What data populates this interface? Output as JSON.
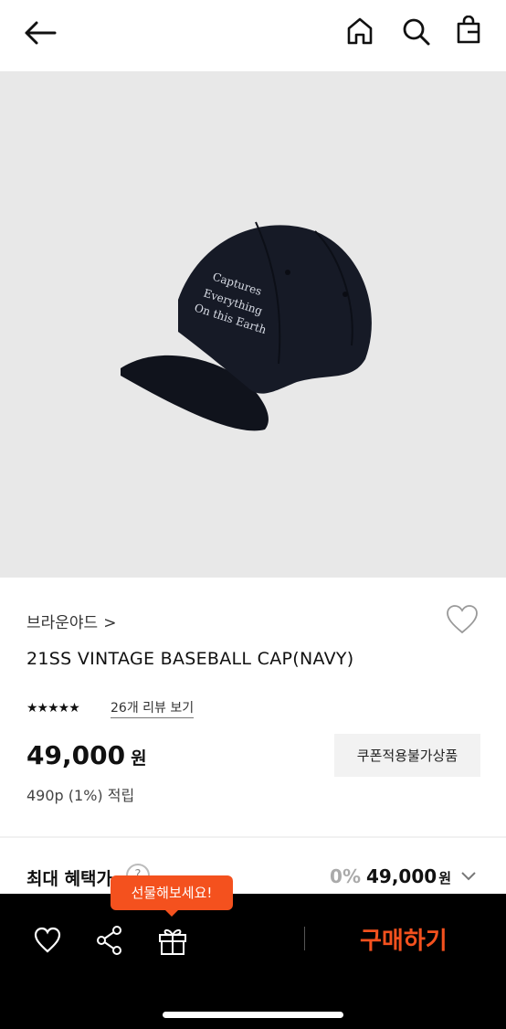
{
  "header": {
    "back_icon": "arrow-left-icon",
    "home_icon": "home-icon",
    "search_icon": "search-icon",
    "bag_icon": "shopping-bag-icon"
  },
  "product": {
    "image_alt": "navy baseball cap with embroidered text",
    "cap_text": [
      "Captures",
      "Everything",
      "On this Earth"
    ],
    "brand": "브라운야드",
    "brand_chevron": ">",
    "title": "21SS VINTAGE BASEBALL CAP(NAVY)",
    "rating": 4.5,
    "stars": "★★★★★",
    "review_link": "26개 리뷰 보기",
    "price": "49,000",
    "price_unit": "원",
    "coupon_button": "쿠폰적용불가상품",
    "points": "490p (1%) 적립"
  },
  "benefit": {
    "label": "최대 혜택가",
    "help": "?",
    "discount": "0%",
    "price": "49,000",
    "unit": "원"
  },
  "bottom_bar": {
    "gift_tooltip": "선물해보세요!",
    "like_icon": "heart-icon",
    "share_icon": "share-icon",
    "gift_icon": "gift-icon",
    "buy_button": "구매하기"
  },
  "colors": {
    "accent": "#f4511e",
    "hero_bg": "#e8e8e8",
    "bottom_bar": "#000000"
  }
}
